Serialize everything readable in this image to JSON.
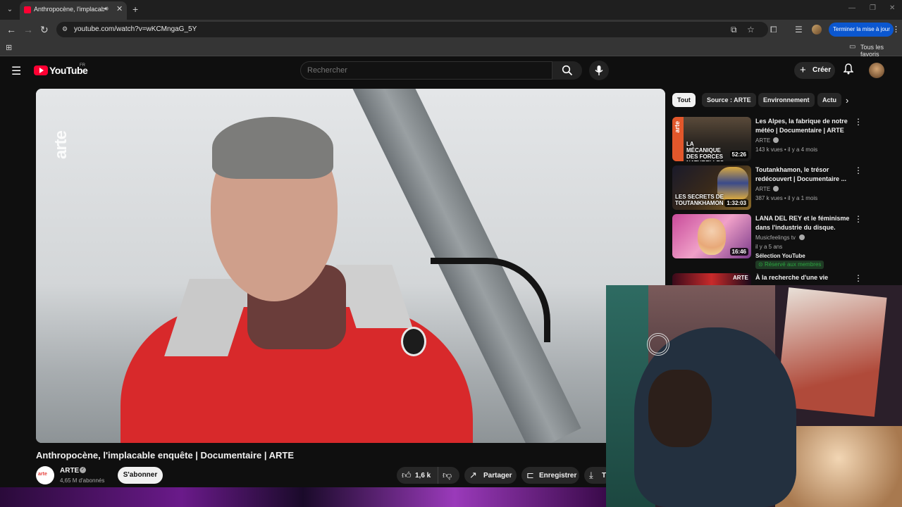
{
  "browser": {
    "tab_title": "Anthropocène, l'implacable",
    "url": "youtube.com/watch?v=wKCMngaG_5Y",
    "update_button": "Terminer la mise à jour",
    "bookmarks_label": "Tous les favoris"
  },
  "youtube": {
    "logo_text": "YouTube",
    "country_code": "FR",
    "search_placeholder": "Rechercher",
    "create_label": "Créer"
  },
  "video": {
    "watermark": "arte",
    "title": "Anthropocène, l'implacable enquête | Documentaire | ARTE",
    "channel": {
      "name": "ARTE",
      "avatar_text": "arte",
      "subscribers": "4,65 M d'abonnés"
    },
    "subscribe_label": "S'abonner",
    "likes": "1,6 k",
    "share_label": "Partager",
    "save_label": "Enregistrer",
    "download_label": "Té"
  },
  "chips": [
    "Tout",
    "Source : ARTE",
    "Environnement",
    "Actu"
  ],
  "recommendations": [
    {
      "title": "Les Alpes, la fabrique de notre météo | Documentaire | ARTE",
      "channel": "ARTE",
      "meta": "143 k vues • il y a 4 mois",
      "duration": "52:26",
      "thumb_text": "LA MÉCANIQUE DES FORCES NATURELLES",
      "thumb_brand": "arte"
    },
    {
      "title": "Toutankhamon, le trésor redécouvert | Documentaire ...",
      "channel": "ARTE",
      "meta": "387 k vues • il y a 1 mois",
      "duration": "1:32:03",
      "thumb_text": "LES SECRETS DE TOUTANKHAMON"
    },
    {
      "title": "LANA DEL REY et le féminisme dans l'industrie du disque.",
      "channel": "Musicfeelings tv",
      "meta": "il y a 5 ans",
      "duration": "16:46",
      "extra": "Sélection YouTube",
      "badge": "Réservé aux membres"
    },
    {
      "title": "À la recherche d'une vie",
      "thumb_brand": "ARTE"
    }
  ],
  "colors": {
    "background": "#0f0f0f",
    "youtube_red": "#ff0033",
    "members_badge": "#2ba640",
    "update_blue": "#0b57d0"
  }
}
